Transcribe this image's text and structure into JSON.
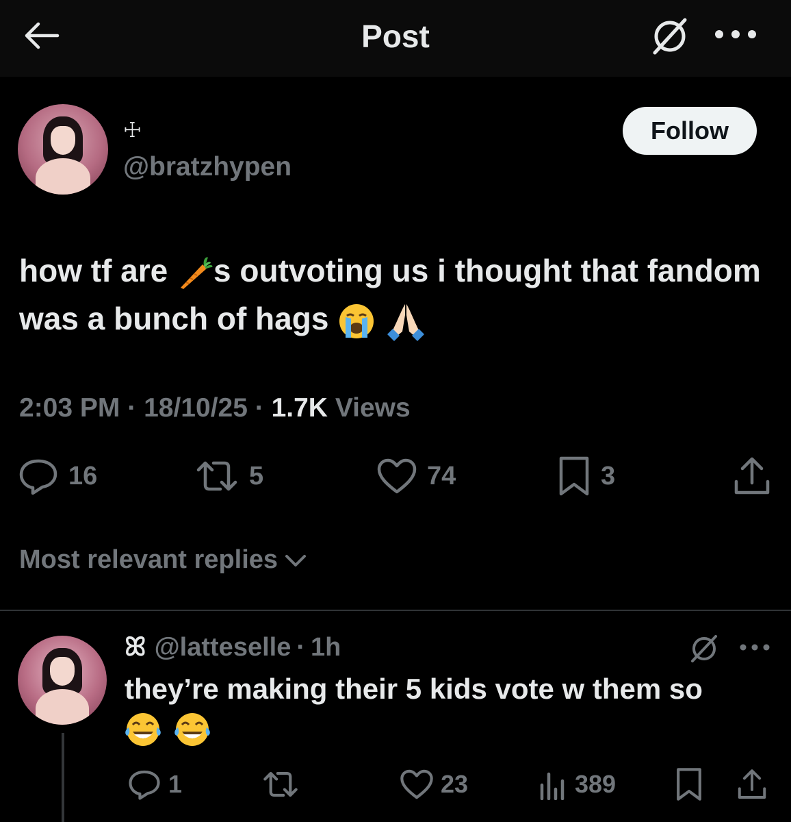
{
  "header": {
    "title": "Post",
    "back_icon": "arrow-left-icon",
    "grok_icon": "grok-icon",
    "more_icon": "more-dots-icon"
  },
  "post": {
    "display_name": "☩",
    "handle": "@bratzhypen",
    "follow_label": "Follow",
    "text_part1": "how tf are ",
    "text_part2": "s outvoting us i thought that fandom was a bunch of hags ",
    "emojis": [
      "carrot-emoji",
      "loudly-crying-face-emoji",
      "folded-hands-emoji"
    ],
    "time": "2:03 PM",
    "date": "18/10/25",
    "views_count": "1.7K",
    "views_label": "Views",
    "separator": "·",
    "stats": {
      "replies": "16",
      "reposts": "5",
      "likes": "74",
      "bookmarks": "3"
    }
  },
  "replies_section": {
    "sort_label": "Most relevant replies"
  },
  "reply": {
    "name_glyph": "ꕤ",
    "handle": "@latteselle",
    "time": "1h",
    "separator": "·",
    "text": "they’re making their 5 kids vote w them so",
    "emojis": [
      "face-with-tears-of-joy-emoji",
      "face-with-tears-of-joy-emoji"
    ],
    "stats": {
      "replies": "1",
      "likes": "23",
      "views": "389"
    }
  },
  "colors": {
    "background": "#000000",
    "header_bg": "#0b0b0b",
    "text_primary": "#e7e9ea",
    "text_secondary": "#71767b",
    "divider": "#2f3336",
    "follow_bg": "#eff3f4"
  }
}
